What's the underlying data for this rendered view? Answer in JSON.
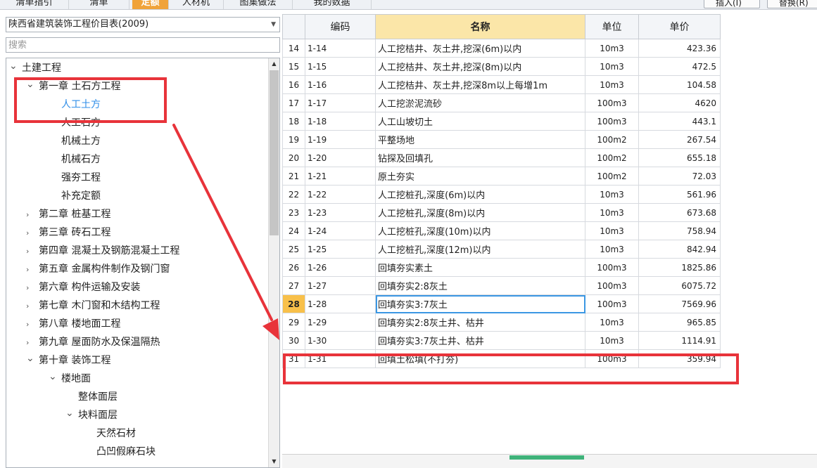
{
  "tabs": [
    "清单指引",
    "清单",
    "定额",
    "人材机",
    "图集做法",
    "我的数据"
  ],
  "active_tab_index": 2,
  "top_buttons": [
    "插入(I)",
    "替换(R)"
  ],
  "library": {
    "selected": "陕西省建筑装饰工程价目表(2009)"
  },
  "search": {
    "placeholder": "搜索",
    "value": ""
  },
  "tree": [
    {
      "label": "土建工程",
      "level": 0,
      "toggle": "expanded"
    },
    {
      "label": "第一章 土石方工程",
      "level": 1,
      "toggle": "expanded"
    },
    {
      "label": "人工土方",
      "level": 2,
      "toggle": "none",
      "selected": true
    },
    {
      "label": "人工石方",
      "level": 2,
      "toggle": "none"
    },
    {
      "label": "机械土方",
      "level": 2,
      "toggle": "none"
    },
    {
      "label": "机械石方",
      "level": 2,
      "toggle": "none"
    },
    {
      "label": "强夯工程",
      "level": 2,
      "toggle": "none"
    },
    {
      "label": "补充定额",
      "level": 2,
      "toggle": "none"
    },
    {
      "label": "第二章 桩基工程",
      "level": 1,
      "toggle": "collapsed"
    },
    {
      "label": "第三章 砖石工程",
      "level": 1,
      "toggle": "collapsed"
    },
    {
      "label": "第四章 混凝土及钢筋混凝土工程",
      "level": 1,
      "toggle": "collapsed"
    },
    {
      "label": "第五章 金属构件制作及钢门窗",
      "level": 1,
      "toggle": "collapsed"
    },
    {
      "label": "第六章 构件运输及安装",
      "level": 1,
      "toggle": "collapsed"
    },
    {
      "label": "第七章 木门窗和木结构工程",
      "level": 1,
      "toggle": "collapsed"
    },
    {
      "label": "第八章 楼地面工程",
      "level": 1,
      "toggle": "collapsed"
    },
    {
      "label": "第九章 屋面防水及保温隔热",
      "level": 1,
      "toggle": "collapsed"
    },
    {
      "label": "第十章 装饰工程",
      "level": 1,
      "toggle": "expanded"
    },
    {
      "label": "楼地面",
      "level": 2,
      "toggle": "expanded"
    },
    {
      "label": "整体面层",
      "level": 3,
      "toggle": "none"
    },
    {
      "label": "块料面层",
      "level": 3,
      "toggle": "expanded"
    },
    {
      "label": "天然石材",
      "level": 4,
      "toggle": "none"
    },
    {
      "label": "凸凹假麻石块",
      "level": 4,
      "toggle": "none"
    }
  ],
  "grid": {
    "headers": {
      "row_no": "",
      "code": "编码",
      "name": "名称",
      "unit": "单位",
      "price": "单价"
    },
    "current_row": "28",
    "rows": [
      {
        "no": "14",
        "code": "1-14",
        "name": "人工挖桔井、灰土井,挖深(6m)以内",
        "unit": "10m3",
        "price": "423.36"
      },
      {
        "no": "15",
        "code": "1-15",
        "name": "人工挖桔井、灰土井,挖深(8m)以内",
        "unit": "10m3",
        "price": "472.5"
      },
      {
        "no": "16",
        "code": "1-16",
        "name": "人工挖桔井、灰土井,挖深8m以上每增1m",
        "unit": "10m3",
        "price": "104.58"
      },
      {
        "no": "17",
        "code": "1-17",
        "name": "人工挖淤泥流砂",
        "unit": "100m3",
        "price": "4620"
      },
      {
        "no": "18",
        "code": "1-18",
        "name": "人工山坡切土",
        "unit": "100m3",
        "price": "443.1"
      },
      {
        "no": "19",
        "code": "1-19",
        "name": "平整场地",
        "unit": "100m2",
        "price": "267.54"
      },
      {
        "no": "20",
        "code": "1-20",
        "name": "钻探及回填孔",
        "unit": "100m2",
        "price": "655.18"
      },
      {
        "no": "21",
        "code": "1-21",
        "name": "原土夯实",
        "unit": "100m2",
        "price": "72.03"
      },
      {
        "no": "22",
        "code": "1-22",
        "name": "人工挖桩孔,深度(6m)以内",
        "unit": "10m3",
        "price": "561.96"
      },
      {
        "no": "23",
        "code": "1-23",
        "name": "人工挖桩孔,深度(8m)以内",
        "unit": "10m3",
        "price": "673.68"
      },
      {
        "no": "24",
        "code": "1-24",
        "name": "人工挖桩孔,深度(10m)以内",
        "unit": "10m3",
        "price": "758.94"
      },
      {
        "no": "25",
        "code": "1-25",
        "name": "人工挖桩孔,深度(12m)以内",
        "unit": "10m3",
        "price": "842.94"
      },
      {
        "no": "26",
        "code": "1-26",
        "name": "回填夯实素土",
        "unit": "100m3",
        "price": "1825.86"
      },
      {
        "no": "27",
        "code": "1-27",
        "name": "回填夯实2:8灰土",
        "unit": "100m3",
        "price": "6075.72"
      },
      {
        "no": "28",
        "code": "1-28",
        "name": "回填夯实3:7灰土",
        "unit": "100m3",
        "price": "7569.96"
      },
      {
        "no": "29",
        "code": "1-29",
        "name": "回填夯实2:8灰土井、枯井",
        "unit": "10m3",
        "price": "965.85"
      },
      {
        "no": "30",
        "code": "1-30",
        "name": "回填夯实3:7灰土井、枯井",
        "unit": "10m3",
        "price": "1114.91"
      },
      {
        "no": "31",
        "code": "1-31",
        "name": "回填土松填(不打夯)",
        "unit": "100m3",
        "price": "359.94"
      }
    ]
  },
  "colors": {
    "active_tab": "#f0a33a",
    "selected_node": "#2f8ee8",
    "annotation_red": "#e8333a",
    "name_header": "#fbe6a8",
    "current_row_marker": "#f8c04a"
  }
}
